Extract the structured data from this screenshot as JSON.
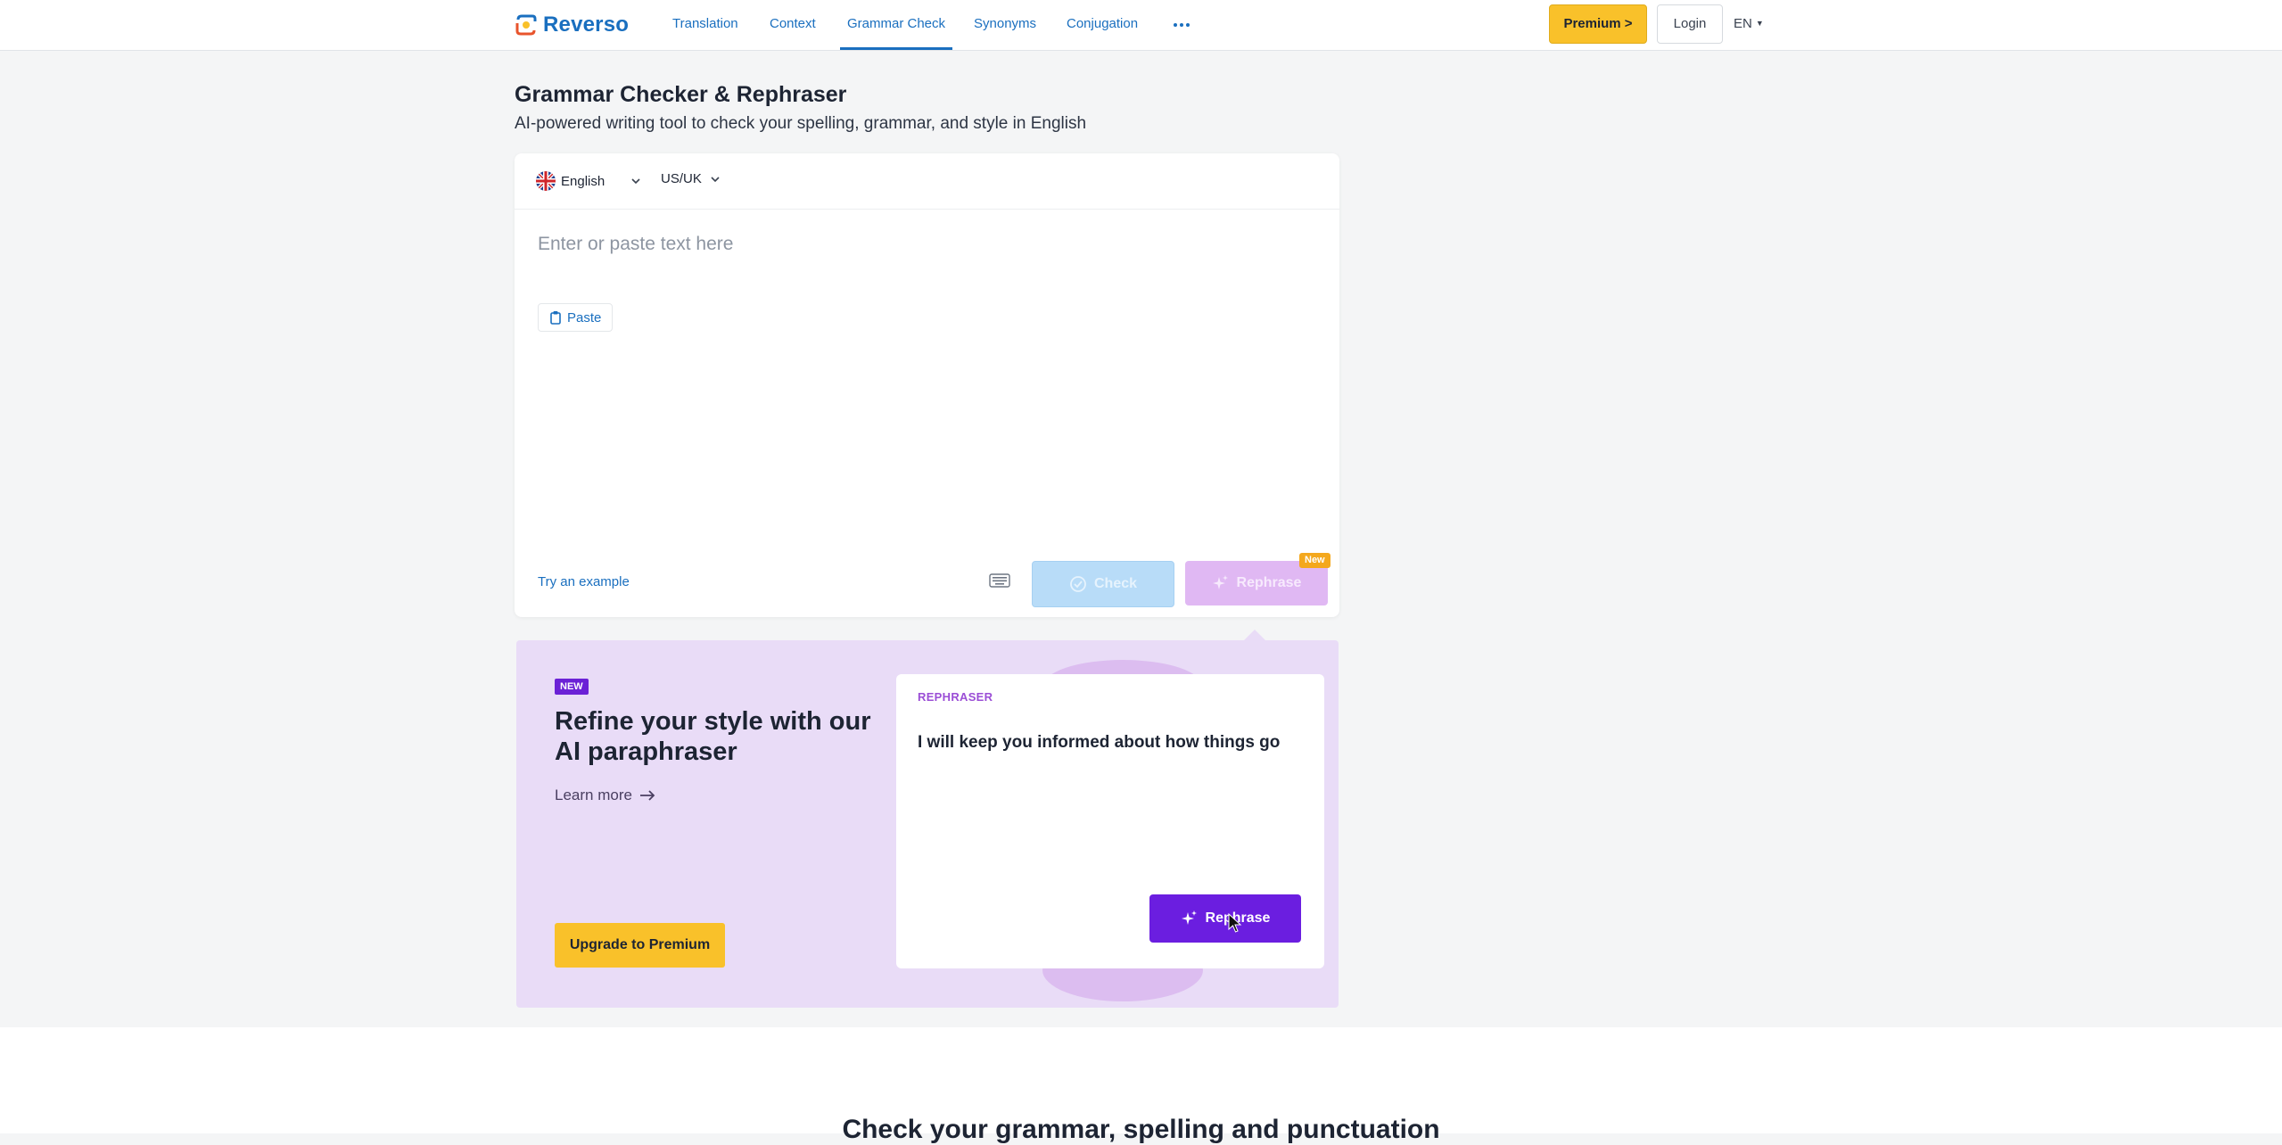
{
  "header": {
    "logo_text": "Reverso",
    "nav": [
      {
        "label": "Translation"
      },
      {
        "label": "Context"
      },
      {
        "label": "Grammar Check",
        "active": true
      },
      {
        "label": "Synonyms"
      },
      {
        "label": "Conjugation"
      }
    ],
    "premium_label": "Premium >",
    "login_label": "Login",
    "language": "EN"
  },
  "page": {
    "title": "Grammar Checker & Rephraser",
    "subtitle": "AI-powered writing tool to check your spelling, grammar, and style in English"
  },
  "editor": {
    "language": "English",
    "variant": "US/UK",
    "placeholder": "Enter or paste text here",
    "paste_label": "Paste",
    "try_example_label": "Try an example",
    "check_label": "Check",
    "rephrase_label": "Rephrase",
    "new_tag": "New"
  },
  "promo": {
    "badge": "NEW",
    "heading": "Refine your style with our AI paraphraser",
    "learn_more": "Learn more",
    "upgrade_label": "Upgrade to Premium",
    "card": {
      "label": "REPHRASER",
      "text": "I will keep you informed about how things go",
      "button_label": "Rephrase"
    }
  },
  "footer": {
    "heading": "Check your grammar, spelling and punctuation"
  },
  "colors": {
    "brand_blue": "#1a6fbf",
    "premium_yellow": "#f9c12a",
    "rephrase_purple": "#6b1ee0",
    "promo_bg": "#e9dcf7"
  },
  "icons": [
    "reverso-logo-icon",
    "more-dots-icon",
    "uk-flag-icon",
    "chevron-down-icon",
    "clipboard-icon",
    "keyboard-icon",
    "check-circle-icon",
    "sparkle-icon",
    "arrow-right-icon",
    "cursor-icon"
  ]
}
